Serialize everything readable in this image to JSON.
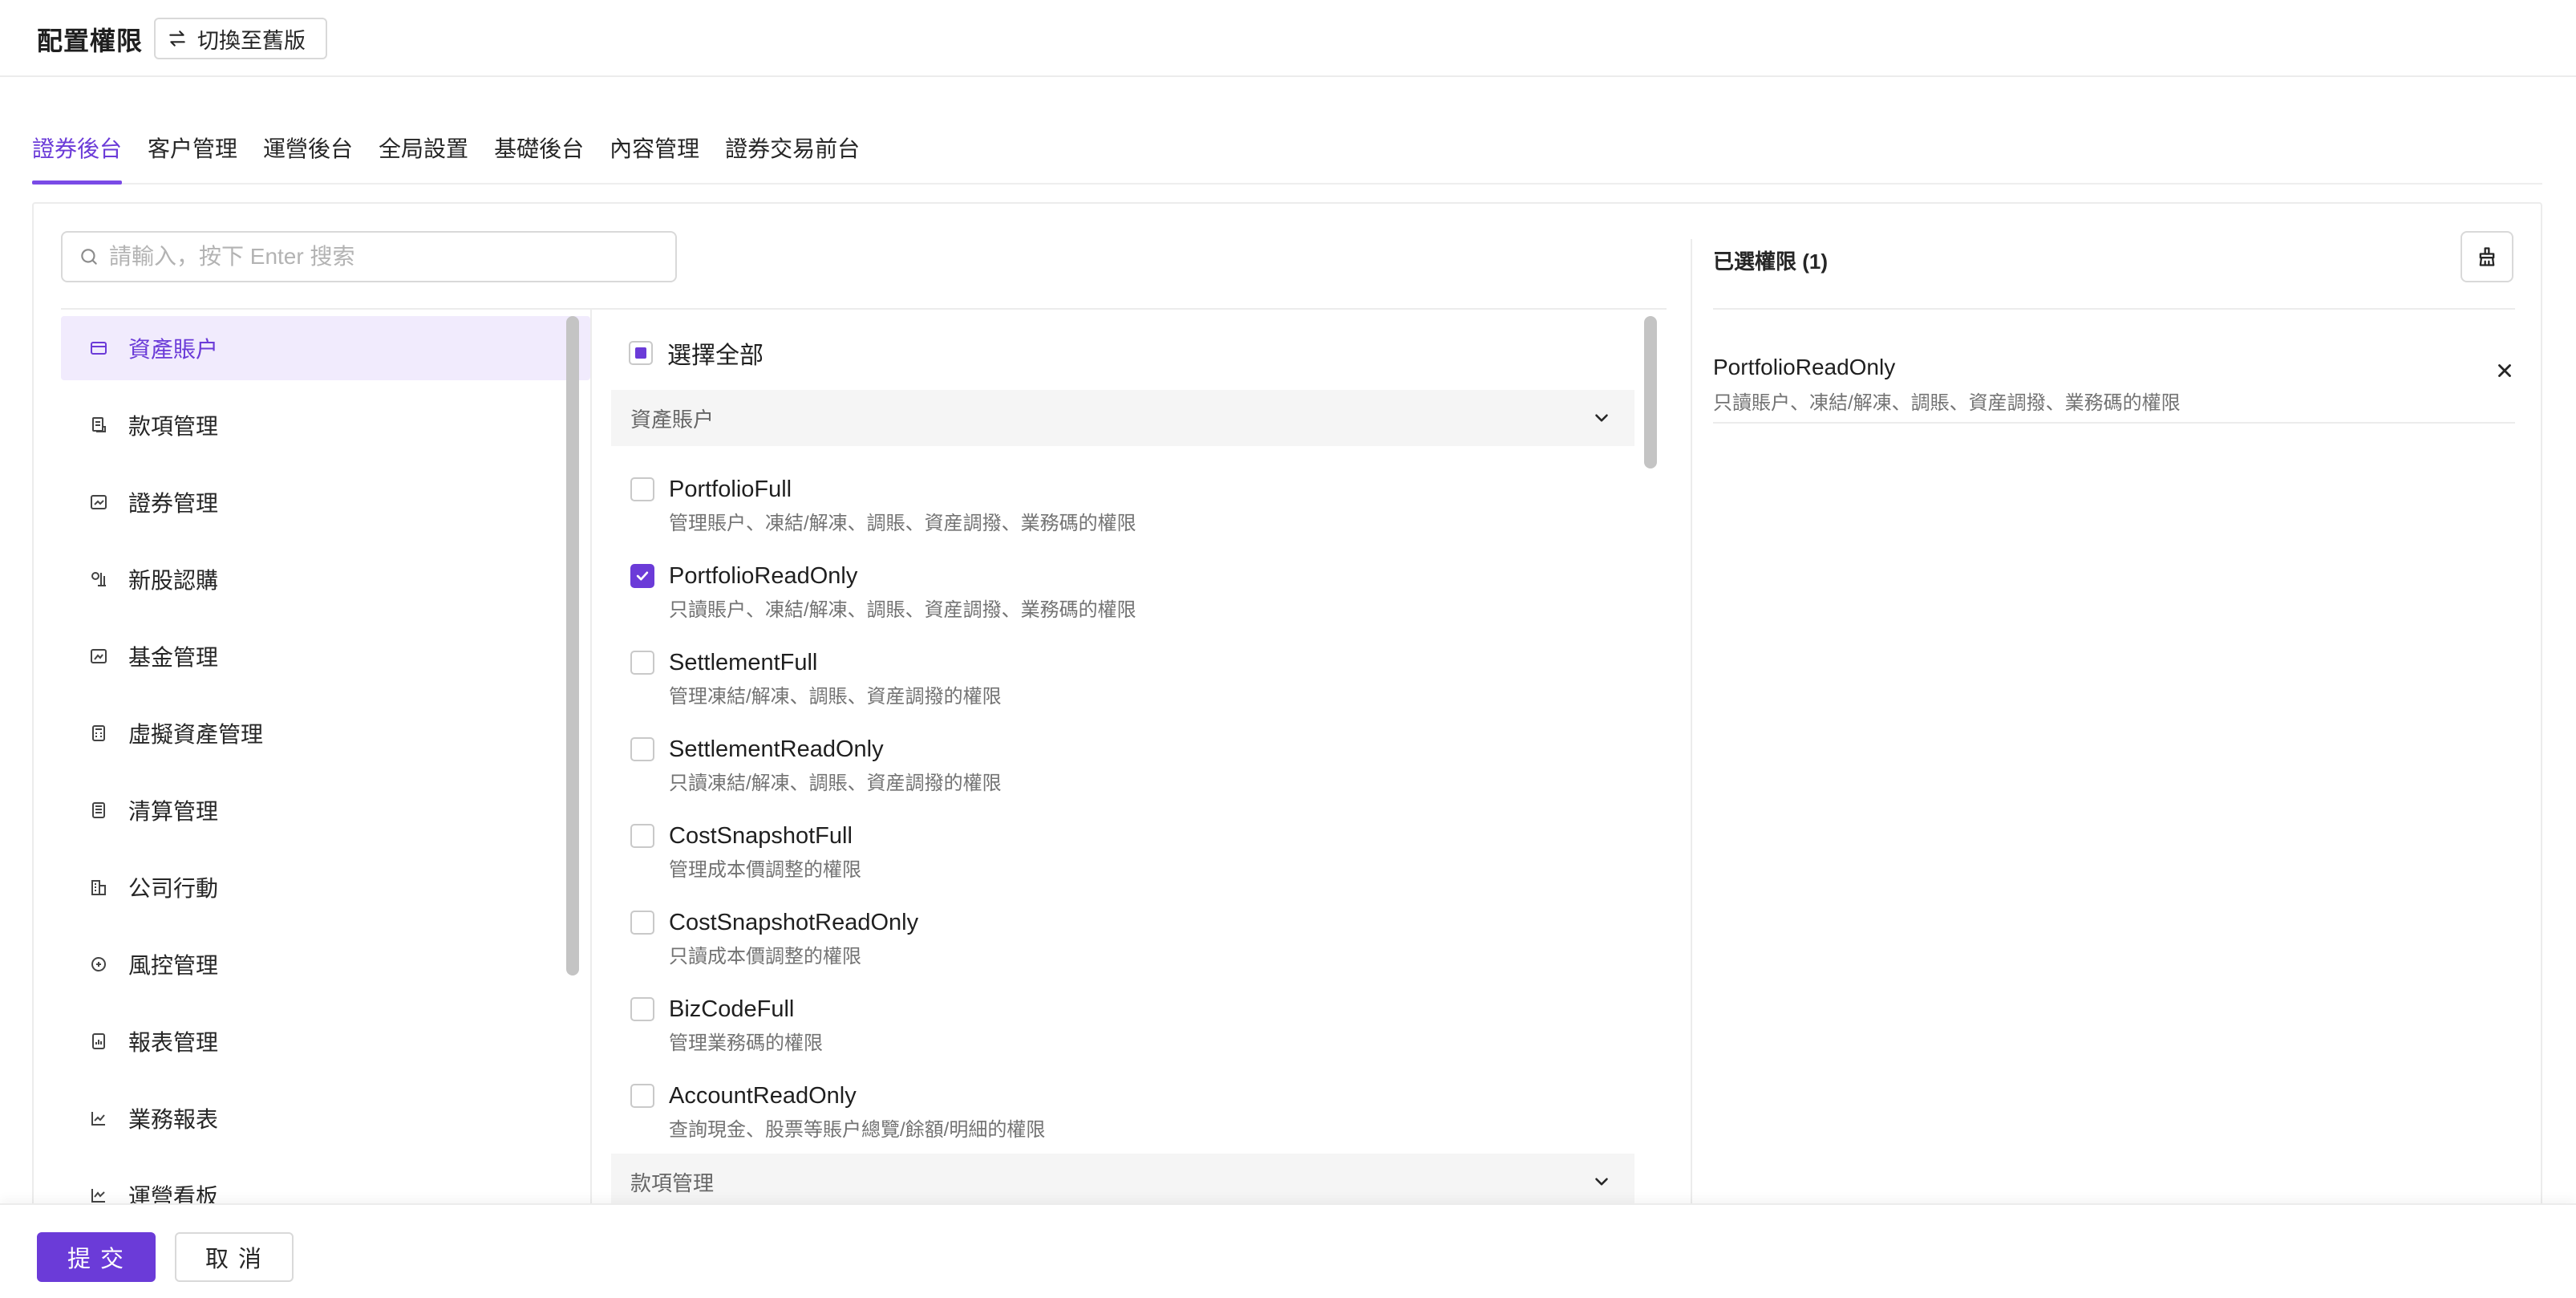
{
  "header": {
    "title": "配置權限",
    "switch_label": "切換至舊版"
  },
  "tabs": [
    {
      "label": "證券後台",
      "active": true
    },
    {
      "label": "客户管理",
      "active": false
    },
    {
      "label": "運營後台",
      "active": false
    },
    {
      "label": "全局設置",
      "active": false
    },
    {
      "label": "基礎後台",
      "active": false
    },
    {
      "label": "內容管理",
      "active": false
    },
    {
      "label": "證券交易前台",
      "active": false
    }
  ],
  "search": {
    "placeholder": "請輸入，按下 Enter 搜索",
    "icon": "search-icon"
  },
  "nav": {
    "items": [
      {
        "label": "資產賬户",
        "icon": "wallet-icon",
        "active": true
      },
      {
        "label": "款項管理",
        "icon": "receipt-icon",
        "active": false
      },
      {
        "label": "證券管理",
        "icon": "securities-icon",
        "active": false
      },
      {
        "label": "新股認購",
        "icon": "ipo-icon",
        "active": false
      },
      {
        "label": "基金管理",
        "icon": "fund-icon",
        "active": false
      },
      {
        "label": "虛擬資產管理",
        "icon": "calculator-icon",
        "active": false
      },
      {
        "label": "清算管理",
        "icon": "clearing-icon",
        "active": false
      },
      {
        "label": "公司行動",
        "icon": "building-icon",
        "active": false
      },
      {
        "label": "風控管理",
        "icon": "risk-icon",
        "active": false
      },
      {
        "label": "報表管理",
        "icon": "report-icon",
        "active": false
      },
      {
        "label": "業務報表",
        "icon": "line-chart-icon",
        "active": false
      },
      {
        "label": "運營看板",
        "icon": "dashboard-icon",
        "active": false
      }
    ]
  },
  "permissions": {
    "select_all_label": "選擇全部",
    "groups": [
      {
        "title": "資產賬户",
        "items": [
          {
            "name": "PortfolioFull",
            "desc": "管理賬户、凍結/解凍、調賬、資産調撥、業務碼的權限",
            "checked": false
          },
          {
            "name": "PortfolioReadOnly",
            "desc": "只讀賬户、凍結/解凍、調賬、資産調撥、業務碼的權限",
            "checked": true
          },
          {
            "name": "SettlementFull",
            "desc": "管理凍結/解凍、調賬、資産調撥的權限",
            "checked": false
          },
          {
            "name": "SettlementReadOnly",
            "desc": "只讀凍結/解凍、調賬、資産調撥的權限",
            "checked": false
          },
          {
            "name": "CostSnapshotFull",
            "desc": "管理成本價調整的權限",
            "checked": false
          },
          {
            "name": "CostSnapshotReadOnly",
            "desc": "只讀成本價調整的權限",
            "checked": false
          },
          {
            "name": "BizCodeFull",
            "desc": "管理業務碼的權限",
            "checked": false
          },
          {
            "name": "AccountReadOnly",
            "desc": "查詢現金、股票等賬户總覽/餘額/明細的權限",
            "checked": false
          }
        ]
      },
      {
        "title": "款項管理",
        "items": []
      }
    ]
  },
  "selected": {
    "title": "已選權限 (1)",
    "items": [
      {
        "name": "PortfolioReadOnly",
        "desc": "只讀賬户、凍結/解凍、調賬、資産調撥、業務碼的權限"
      }
    ]
  },
  "footer": {
    "submit_label": "提 交",
    "cancel_label": "取 消"
  },
  "colors": {
    "accent": "#6b3bd8",
    "accent_light": "#f1ebfd"
  }
}
